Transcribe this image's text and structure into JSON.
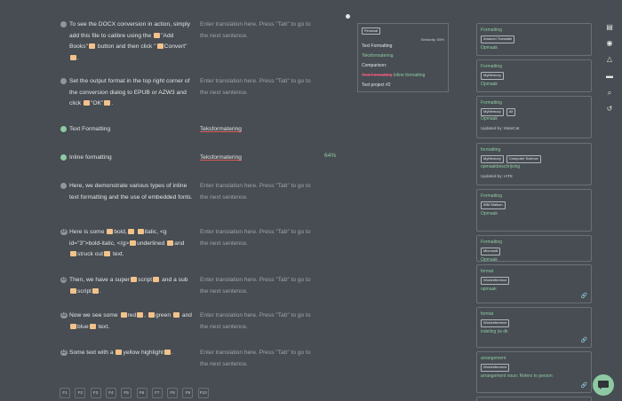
{
  "segments": [
    {
      "n": "",
      "src_html": "To see the DOCX conversion in action, simply add this file to calibre using the <span class=tag></span>\"Add Books\"<span class=tag></span> button and then click \"<span class=tag></span>Convert\"<span class=tag></span>.",
      "tgt": "Enter translation here. Press \"Tab\" to go to the next sentence.",
      "done": false
    },
    {
      "n": "",
      "src_html": "Set the output format in the top right corner of the conversion dialog to EPUB or AZW3 and click <span class=tag></span>\"OK\"<span class=tag></span>.",
      "tgt": "Enter translation here. Press \"Tab\" to go to the next sentence.",
      "done": false
    },
    {
      "n": "",
      "src_html": "Text Formatting",
      "tgt": "Teksformatering",
      "done": true
    },
    {
      "n": "",
      "src_html": "Inline formatting",
      "tgt": "Teksformatering",
      "done": true,
      "pct": "64%"
    },
    {
      "n": "",
      "src_html": "Here, we demonstrate various types of inline text formatting and the use of embedded fonts.",
      "tgt": "Enter translation here. Press \"Tab\" to go to the next sentence.",
      "done": false
    },
    {
      "n": "10",
      "src_html": "Here is some <span class=tag></span>bold,<span class=tag></span> <span class=tag></span>italic, &lt;g id=\"3\"&gt;bold-italic, &lt;/g&gt;<span class=tag></span>underlined <span class=tag></span>and <span class=tag></span>struck out<span class=tag></span> text.",
      "tgt": "Enter translation here. Press \"Tab\" to go to the next sentence.",
      "done": false
    },
    {
      "n": "11",
      "src_html": "Then, we have a super<span class=tag></span>script<span class=tag></span> and a sub<span class=tag></span>script<span class=tag></span>.",
      "tgt": "Enter translation here. Press \"Tab\" to go to the next sentence.",
      "done": false
    },
    {
      "n": "12",
      "src_html": "Now we see some <span class=tag></span>red<span class=tag></span>, <span class=tag></span>green <span class=tag></span> and <span class=tag></span>blue<span class=tag></span> text.",
      "tgt": "Enter translation here. Press \"Tab\" to go to the next sentence.",
      "done": false
    },
    {
      "n": "13",
      "src_html": "Some text with a <span class=tag></span>yellow highlight<span class=tag></span>.",
      "tgt": "Enter translation here. Press \"Tab\" to go to the next sentence.",
      "done": false
    }
  ],
  "fkeys": [
    "F1",
    "F2",
    "F3",
    "F4",
    "F5",
    "F6",
    "F7",
    "F8",
    "F9",
    "F10"
  ],
  "compare": {
    "badge": "Personal",
    "similarity": "Similarity: 65%",
    "source": "Text Formatting",
    "target": "Teksformatering",
    "label": "Comparison:",
    "diff_del": "Text Formatting",
    "diff_ins": "Inline formatting",
    "project": "Test project #2"
  },
  "cards": [
    {
      "title": "Formatting",
      "chips": [
        "Amazon Translate"
      ],
      "match": "Opmaak"
    },
    {
      "title": "Formatting",
      "chips": [
        "MyMemory"
      ],
      "match": "Opmaak"
    },
    {
      "title": "Formatting",
      "chips": [
        "MyMemory",
        "All"
      ],
      "match": "Opmaak",
      "updated": "Updated by: MateCat"
    },
    {
      "title": "formatting",
      "chips": [
        "MyMemory",
        "Computer Science"
      ],
      "match": "opmaakbeschrijving",
      "updated": "Updated by: IATE"
    },
    {
      "title": "Formatting",
      "chips": [
        "IBM Watson"
      ],
      "match": "Opmaak"
    },
    {
      "title": "Formatting",
      "chips": [
        "Microsoft"
      ],
      "match": "Opmaak"
    },
    {
      "title": "format",
      "chips": [
        "Wordreference"
      ],
      "match": "opmaak",
      "link": true
    },
    {
      "title": "format",
      "chips": [
        "Wordreference"
      ],
      "match": "indeling (w dk",
      "link": true
    },
    {
      "title": "arrangement",
      "chips": [
        "Wordreference"
      ],
      "match": "arrangement noun: Refers to person",
      "link": true
    }
  ],
  "rail": [
    "book-icon",
    "eye-icon",
    "drive-icon",
    "comment-icon",
    "search-icon",
    "history-icon"
  ],
  "colors": {
    "bg": "#474d52",
    "accent": "#8ec9a4",
    "tag": "#f2c28b"
  }
}
